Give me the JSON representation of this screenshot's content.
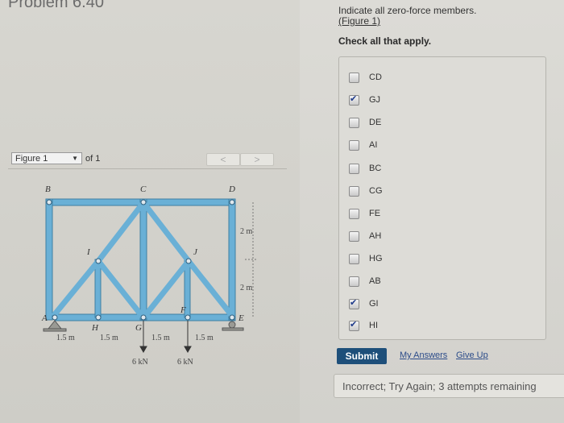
{
  "problem": {
    "title": "Problem 6.40"
  },
  "question": {
    "prompt": "Indicate all zero-force members.",
    "figure_link": "(Figure 1)",
    "instruction": "Check all that apply."
  },
  "choices": [
    {
      "label": "CD",
      "checked": false
    },
    {
      "label": "GJ",
      "checked": true
    },
    {
      "label": "DE",
      "checked": false
    },
    {
      "label": "AI",
      "checked": false
    },
    {
      "label": "BC",
      "checked": false
    },
    {
      "label": "CG",
      "checked": false
    },
    {
      "label": "FE",
      "checked": false
    },
    {
      "label": "AH",
      "checked": false
    },
    {
      "label": "HG",
      "checked": false
    },
    {
      "label": "AB",
      "checked": false
    },
    {
      "label": "GI",
      "checked": true
    },
    {
      "label": "HI",
      "checked": true
    }
  ],
  "actions": {
    "submit": "Submit",
    "my_answers": "My Answers",
    "give_up": "Give Up"
  },
  "feedback": "Incorrect; Try Again; 3 attempts remaining",
  "figure": {
    "selector": "Figure 1",
    "of_text": "of 1",
    "prev": "<",
    "next": ">",
    "nodes": {
      "A": "A",
      "B": "B",
      "C": "C",
      "D": "D",
      "E": "E",
      "F": "F",
      "G": "G",
      "H": "H",
      "I": "I",
      "J": "J"
    },
    "dims": {
      "height_top": "2 m",
      "height_bottom": "2 m",
      "span1": "1.5 m",
      "span2": "1.5 m",
      "span3": "1.5 m",
      "span4": "1.5 m"
    },
    "loads": {
      "load1": "6 kN",
      "load2": "6 kN"
    }
  },
  "colors": {
    "truss": "#6ab0d6",
    "truss_edge": "#3f7fa3",
    "submit_bg": "#1e4f7a",
    "check": "#1e3a8a"
  }
}
